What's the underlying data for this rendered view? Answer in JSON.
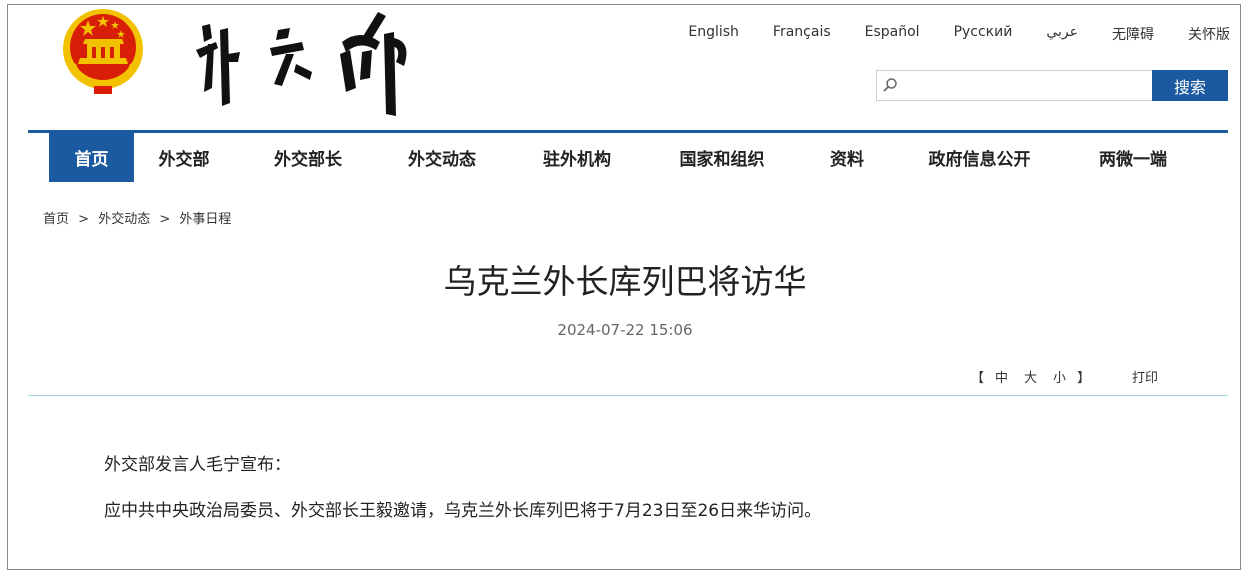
{
  "header": {
    "languages": [
      "English",
      "Français",
      "Español",
      "Русский",
      "عربي",
      "无障碍",
      "关怀版"
    ],
    "search": {
      "placeholder": "",
      "button_label": "搜索"
    }
  },
  "nav": {
    "items": [
      {
        "label": "首页",
        "active": true
      },
      {
        "label": "外交部",
        "active": false
      },
      {
        "label": "外交部长",
        "active": false
      },
      {
        "label": "外交动态",
        "active": false
      },
      {
        "label": "驻外机构",
        "active": false
      },
      {
        "label": "国家和组织",
        "active": false
      },
      {
        "label": "资料",
        "active": false
      },
      {
        "label": "政府信息公开",
        "active": false
      },
      {
        "label": "两微一端",
        "active": false
      }
    ]
  },
  "breadcrumb": {
    "items": [
      "首页",
      "外交动态",
      "外事日程"
    ],
    "separator": ">"
  },
  "article": {
    "title": "乌克兰外长库列巴将访华",
    "datetime": "2024-07-22 15:06",
    "font_size": {
      "open_bracket": "【",
      "medium": "中",
      "large": "大",
      "small": "小",
      "close_bracket": "】"
    },
    "print_label": "打印",
    "paragraphs": [
      "外交部发言人毛宁宣布：",
      "应中共中央政治局委员、外交部长王毅邀请，乌克兰外长库列巴将于7月23日至26日来华访问。"
    ]
  },
  "colors": {
    "brand_blue": "#1b5aa0",
    "divider_teal": "#9fd3da",
    "emblem_red": "#d81e06",
    "emblem_gold": "#f2c200"
  }
}
